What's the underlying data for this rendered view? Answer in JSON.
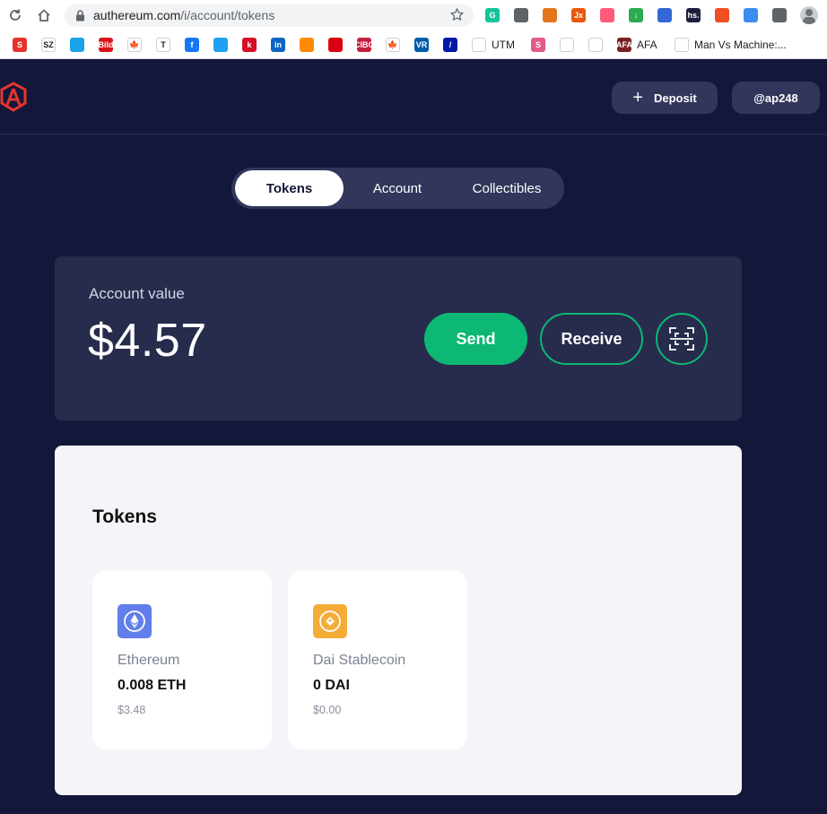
{
  "browser": {
    "url_host": "authereum.com",
    "url_path": "/i/account/tokens",
    "extensions": [
      {
        "icon": "grammarly-icon",
        "color": "#15c39a",
        "text": "G"
      },
      {
        "icon": "circle-extension-icon",
        "color": "#5f6368",
        "text": ""
      },
      {
        "icon": "metamask-icon",
        "color": "#e2761b",
        "text": ""
      },
      {
        "icon": "jx-extension-icon",
        "color": "#e8590c",
        "text": "Jx"
      },
      {
        "icon": "arrow-extension-icon",
        "color": "#ff5a79",
        "text": ""
      },
      {
        "icon": "download-extension-icon",
        "color": "#2da94f",
        "text": "↓"
      },
      {
        "icon": "graduation-cap-icon",
        "color": "#3367d6",
        "text": ""
      },
      {
        "icon": "hs-extension-icon",
        "color": "#1b1f3b",
        "text": "hs."
      },
      {
        "icon": "heart-extension-icon",
        "color": "#f04e23",
        "text": ""
      },
      {
        "icon": "cloud-extension-icon",
        "color": "#3b8df0",
        "text": ""
      },
      {
        "icon": "puzzle-icon",
        "color": "#5f6368",
        "text": ""
      }
    ],
    "bookmarks": [
      {
        "icon": "s-red-favicon",
        "color": "#e5322d",
        "text": "S",
        "label": ""
      },
      {
        "icon": "sz-favicon",
        "color": "#ffffff",
        "text": "SZ",
        "label": ""
      },
      {
        "icon": "edge-favicon",
        "color": "#1ba3e8",
        "text": "",
        "label": ""
      },
      {
        "icon": "bild-favicon",
        "color": "#d7141a",
        "text": "Bild",
        "label": ""
      },
      {
        "icon": "maple-leaf-favicon",
        "color": "#ffffff",
        "text": "🍁",
        "label": ""
      },
      {
        "icon": "nyt-favicon",
        "color": "#ffffff",
        "text": "T",
        "label": ""
      },
      {
        "icon": "facebook-favicon",
        "color": "#1877f2",
        "text": "f",
        "label": ""
      },
      {
        "icon": "twitter-favicon",
        "color": "#1da1f2",
        "text": "",
        "label": ""
      },
      {
        "icon": "k-favicon",
        "color": "#d50f25",
        "text": "k",
        "label": ""
      },
      {
        "icon": "linkedin-favicon",
        "color": "#0a66c2",
        "text": "in",
        "label": ""
      },
      {
        "icon": "funnel-favicon",
        "color": "#ff8a00",
        "text": "",
        "label": ""
      },
      {
        "icon": "hsbc-favicon",
        "color": "#db0011",
        "text": "",
        "label": ""
      },
      {
        "icon": "cibc-favicon",
        "color": "#c41f3e",
        "text": "CIBC",
        "label": ""
      },
      {
        "icon": "canada-leaf-favicon",
        "color": "#ffffff",
        "text": "🍁",
        "label": ""
      },
      {
        "icon": "vr-favicon",
        "color": "#005ca9",
        "text": "VR",
        "label": ""
      },
      {
        "icon": "deutsche-bank-favicon",
        "color": "#0018a8",
        "text": "/",
        "label": ""
      },
      {
        "icon": "utm-favicon",
        "color": "#ffffff",
        "text": "",
        "label": "UTM"
      },
      {
        "icon": "s-pink-favicon",
        "color": "#e05a8a",
        "text": "S",
        "label": ""
      },
      {
        "icon": "bars-favicon",
        "color": "#ffffff",
        "text": "",
        "label": ""
      },
      {
        "icon": "fingerprint-favicon",
        "color": "#ffffff",
        "text": "",
        "label": ""
      },
      {
        "icon": "afa-favicon",
        "color": "#7a1f1f",
        "text": "AFA",
        "label": "AFA"
      },
      {
        "icon": "github-favicon",
        "color": "#ffffff",
        "text": "",
        "label": "Man Vs Machine:..."
      }
    ]
  },
  "header": {
    "deposit_label": "Deposit",
    "user_label": "@ap248"
  },
  "tabs": [
    {
      "label": "Tokens",
      "active": true
    },
    {
      "label": "Account",
      "active": false
    },
    {
      "label": "Collectibles",
      "active": false
    }
  ],
  "account": {
    "label": "Account value",
    "value": "$4.57",
    "send_label": "Send",
    "receive_label": "Receive"
  },
  "tokens": {
    "heading": "Tokens",
    "items": [
      {
        "icon": "ethereum-icon",
        "name": "Ethereum",
        "amount": "0.008 ETH",
        "fiat": "$3.48",
        "color": "#627eea"
      },
      {
        "icon": "dai-icon",
        "name": "Dai Stablecoin",
        "amount": "0 DAI",
        "fiat": "$0.00",
        "color": "#f5ac37"
      }
    ]
  },
  "colors": {
    "background": "#131739",
    "card": "#272c4d",
    "accent": "#0cb873",
    "logo": "#e5352d"
  }
}
